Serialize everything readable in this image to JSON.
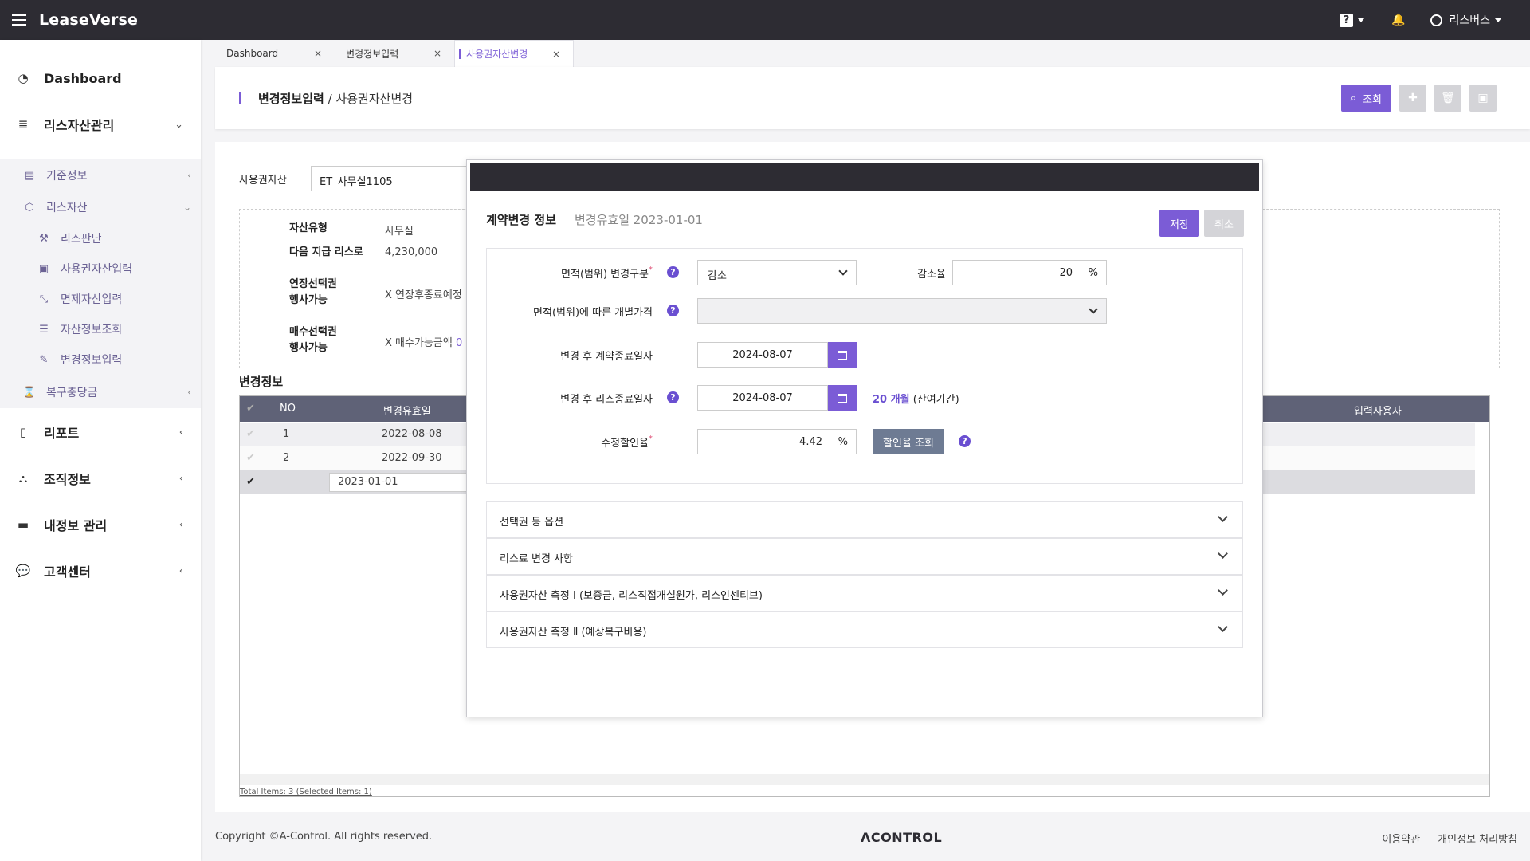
{
  "app": {
    "brand": "LeaseVerse",
    "help_label": "?",
    "user_name": "리스버스"
  },
  "sidebar": {
    "dashboard": "Dashboard",
    "lease_asset_mgmt": "리스자산관리",
    "base_info": "기준정보",
    "lease_asset": "리스자산",
    "lease_judgement": "리스판단",
    "rou_input": "사용권자산입력",
    "exempt_input": "면제자산입력",
    "asset_inquiry": "자산정보조회",
    "change_input": "변경정보입력",
    "restoration": "복구충당금",
    "report": "리포트",
    "org_info": "조직정보",
    "my_info": "내정보 관리",
    "customer_center": "고객센터"
  },
  "tabs": [
    {
      "label": "Dashboard",
      "close": "×"
    },
    {
      "label": "변경정보입력",
      "close": "×"
    },
    {
      "label": "사용권자산변경",
      "close": "×"
    }
  ],
  "page": {
    "title_main": "변경정보입력",
    "title_sep": "/",
    "title_sub": "사용권자산변경",
    "search_label": "조회"
  },
  "asset": {
    "label": "사용권자산",
    "value": "ET_사무실1105",
    "type_label": "자산유형",
    "type_value": "사무실",
    "next_pay_label": "다음 지급 리스로",
    "next_pay_value": "4,230,000",
    "ext_label_1": "연장선택권",
    "ext_label_2": "행사가능",
    "ext_value": "X 연장후종료예정",
    "buy_label_1": "매수선택권",
    "buy_label_2": "행사가능",
    "buy_value": "X 매수가능금액",
    "buy_value_suffix": "0"
  },
  "change_section": {
    "title": "변경정보"
  },
  "grid": {
    "columns": {
      "check": "✔",
      "no": "NO",
      "eff_date": "변경유효일",
      "input_user": "입력사용자"
    },
    "rows": [
      {
        "check": "✔",
        "no": "1",
        "eff_date": "2022-08-08"
      },
      {
        "check": "✔",
        "no": "2",
        "eff_date": "2022-09-30"
      },
      {
        "check": "✔",
        "no": "",
        "eff_date": "2023-01-01"
      }
    ],
    "total": "Total Items: 3 (Selected Items: 1)"
  },
  "modal": {
    "title": "계약변경 정보",
    "subtitle": "변경유효일 2023-01-01",
    "save": "저장",
    "cancel": "취소",
    "area_change_label": "면적(범위) 변경구분",
    "area_change_value": "감소",
    "decrease_rate_label": "감소율",
    "decrease_rate_value": "20",
    "percent": "%",
    "individual_price_label": "면적(범위)에 따른 개별가격",
    "individual_price_value": "",
    "contract_end_label": "변경 후 계약종료일자",
    "contract_end_value": "2024-08-07",
    "lease_end_label": "변경 후 리스종료일자",
    "lease_end_value": "2024-08-07",
    "remaining_months": "20 개월",
    "remaining_suffix": "(잔여기간)",
    "discount_label": "수정할인율",
    "discount_value": "4.42",
    "rate_inquiry": "할인율 조회",
    "required_mark": "*",
    "help": "?",
    "accordion": [
      "선택권 등 옵션",
      "리스료 변경 사항",
      "사용권자산 측정 Ⅰ (보증금, 리스직접개설원가, 리스인센티브)",
      "사용권자산 측정 Ⅱ (예상복구비용)"
    ]
  },
  "footer": {
    "copyright": "Copyright ©A-Control. All rights reserved.",
    "logo": "ΛCONTROL",
    "terms": "이용약관",
    "privacy": "개인정보 처리방침"
  },
  "colors": {
    "accent": "#7b5cd6",
    "header_bg": "#2d2c33",
    "grid_head": "#5f6277"
  }
}
